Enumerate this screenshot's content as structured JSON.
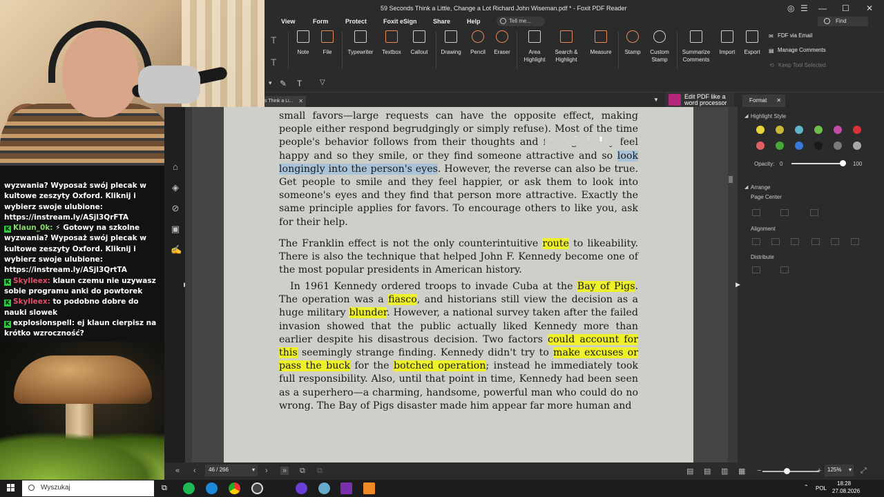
{
  "window": {
    "title": "59 Seconds Think a Little, Change a Lot Richard John Wiseman.pdf * - Foxit PDF Reader"
  },
  "menu": {
    "items": [
      "View",
      "Form",
      "Protect",
      "Foxit eSign",
      "Share",
      "Help"
    ],
    "tell_me": "Tell me...",
    "find": "Find"
  },
  "ribbon": {
    "buttons": [
      "Note",
      "File",
      "Typewriter",
      "Textbox",
      "Callout",
      "Drawing",
      "Pencil",
      "Eraser",
      "Area Highlight",
      "Search & Highlight",
      "Measure",
      "Stamp",
      "Custom Stamp",
      "Summarize Comments",
      "Import",
      "Export"
    ],
    "side_actions": [
      "FDF via Email",
      "Manage Comments",
      "Keep Tool Selected"
    ]
  },
  "tabs": {
    "doc_tab": "s Think a Li...",
    "promo_line1": "Edit PDF like a",
    "promo_line2": "word processor"
  },
  "document": {
    "para1": [
      {
        "t": "small favors—large requests can have the opposite effect, making people either respond begrudgingly or simply refuse). Most of the time people's behavior follows from their thoughts and feelings. Th",
        "h": ""
      },
      {
        "t": "ey feel happy",
        "h": ""
      },
      {
        "t": " and so they smile, or they find someone attractive and so ",
        "h": ""
      },
      {
        "t": "look longingly into the person's eyes",
        "h": "b"
      },
      {
        "t": ". However, the reverse can also be true. Get people to smile and they feel happier, or ask them to look into someone's eyes and they find that person more attractive. Exactly the same principle applies for favors. To encourage others to like you, ask for their help.",
        "h": ""
      }
    ],
    "para2": [
      {
        "t": "The Franklin effect is not the only counterintuitive ",
        "h": ""
      },
      {
        "t": "route",
        "h": "y"
      },
      {
        "t": " to likeability. There is also the technique that helped John F. Kennedy become one of the most popular presidents in American history.",
        "h": ""
      }
    ],
    "para3": [
      {
        "t": "In 1961 Kennedy ordered troops to invade Cuba at the ",
        "h": ""
      },
      {
        "t": "Bay of Pigs",
        "h": "y"
      },
      {
        "t": ". The operation was a ",
        "h": ""
      },
      {
        "t": "fiasco",
        "h": "y"
      },
      {
        "t": ", and historians still view the decision as a huge military ",
        "h": ""
      },
      {
        "t": "blunder",
        "h": "y"
      },
      {
        "t": ". However, a national survey taken after the failed invasion showed that the public actually liked Kennedy more than earlier despite his disastrous decision. Two factors ",
        "h": ""
      },
      {
        "t": "could account for this",
        "h": "y"
      },
      {
        "t": " seemingly strange finding. Kennedy didn't try to ",
        "h": ""
      },
      {
        "t": "make excuses or pass the buck",
        "h": "y"
      },
      {
        "t": " for the ",
        "h": ""
      },
      {
        "t": "botched operation",
        "h": "y"
      },
      {
        "t": "; instead he immediately took full responsibility. Also, until that point in time, Kennedy had been seen as a superhero—a charming, handsome, powerful man who could do no wrong. The Bay of Pigs disaster made him appear far more human and",
        "h": ""
      }
    ]
  },
  "panel": {
    "tab": "Format",
    "highlight_style": "Highlight Style",
    "opacity_label": "Opacity:",
    "opacity_min": "0",
    "opacity_max": "100",
    "opacity_value": 1.0,
    "arrange": "Arrange",
    "page_center": "Page Center",
    "alignment": "Alignment",
    "distribute": "Distribute",
    "colors": [
      "#e8d53a",
      "#c7b83a",
      "#5fb6c8",
      "#6bbf4a",
      "#c84aa8",
      "#d8323a",
      "#e06060",
      "#48a838",
      "#3a78d8",
      "#1a1a1a",
      "#7a7a7a",
      "#a8a8a8"
    ]
  },
  "status": {
    "page": "46 / 266",
    "zoom": "125%"
  },
  "chat": [
    {
      "user": "",
      "badge": false,
      "ucolor": "white",
      "text": "wyzwania? Wyposaż swój plecak w kultowe zeszyty Oxford. Kliknij i wybierz swoje ulubione: https://instream.ly/ASjl3QrFTA"
    },
    {
      "user": "Klaun_0k:",
      "badge": true,
      "ucolor": "green",
      "text": "⚡ Gotowy na szkolne wyzwania? Wyposaż swój plecak w kultowe zeszyty Oxford. Kliknij i wybierz swoje ulubione: https://instream.ly/ASjl3QrtTA"
    },
    {
      "user": "Skylleex:",
      "badge": true,
      "ucolor": "red",
      "text": "klaun czemu nie uzywasz sobie programu anki do powtorek"
    },
    {
      "user": "Skylleex:",
      "badge": true,
      "ucolor": "red",
      "text": "to podobno dobre do nauki slowek"
    },
    {
      "user": "explosionspell:",
      "badge": true,
      "ucolor": "white",
      "text": "ej klaun cierpisz na krótko wzroczność?"
    }
  ],
  "taskbar": {
    "search_placeholder": "Wyszukaj",
    "lang": "POL",
    "time": "18:28",
    "date": "27.08.2026"
  }
}
